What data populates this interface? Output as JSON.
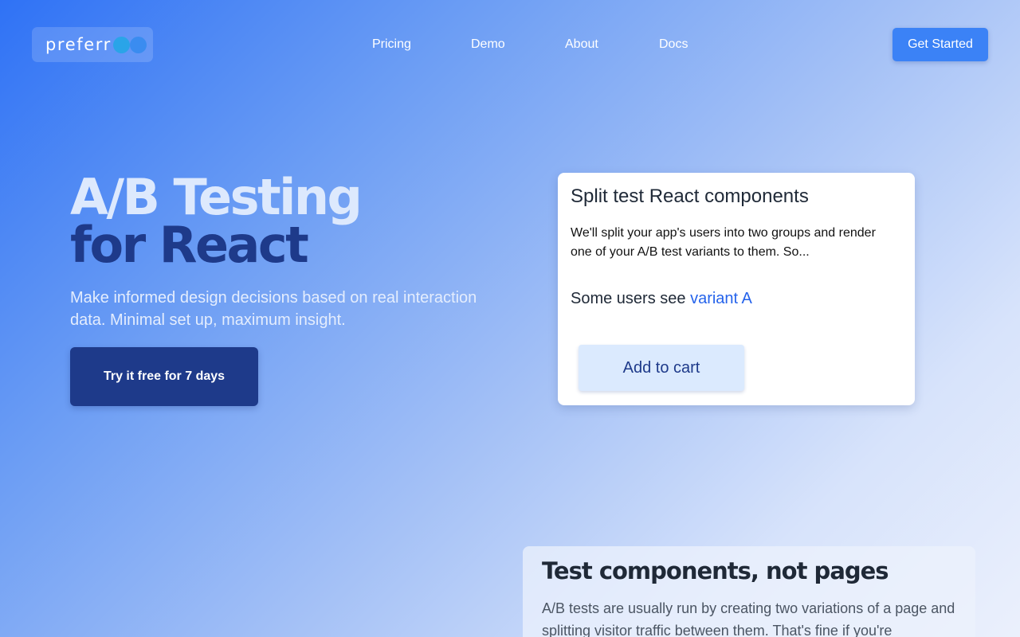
{
  "header": {
    "logo_text": "preferr",
    "nav": {
      "pricing": "Pricing",
      "demo": "Demo",
      "about": "About",
      "docs": "Docs"
    },
    "cta_label": "Get Started"
  },
  "hero": {
    "title_line1": "A/B Testing",
    "title_line2": "for React",
    "subtitle": "Make informed design decisions based on real interaction data. Minimal set up, maximum insight.",
    "cta_label": "Try it free for 7 days"
  },
  "demo_card": {
    "title": "Split test React components",
    "description": "We'll split your app's users into two groups and render one of your A/B test variants to them. So...",
    "variant_prefix": "Some users see ",
    "variant_name": "variant A",
    "button_label": "Add to cart"
  },
  "section": {
    "title": "Test components, not pages",
    "text": "A/B tests are usually run by creating two variations of a page and splitting visitor traffic between them. That's fine if you're"
  },
  "colors": {
    "primary_dark": "#1e3a8a",
    "accent": "#3b82f6",
    "link": "#2563eb",
    "light_blue": "#dbeafe"
  },
  "icons": [
    "logo-dot-icon"
  ]
}
